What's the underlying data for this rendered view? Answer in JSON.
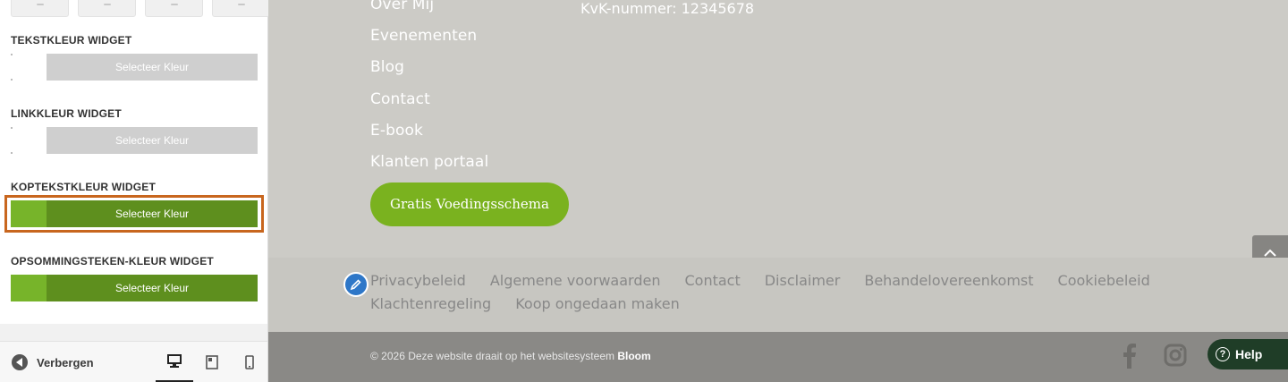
{
  "sidebar": {
    "sections": [
      {
        "title": "TEKSTKLEUR WIDGET",
        "button": "Selecteer Kleur"
      },
      {
        "title": "LINKKLEUR WIDGET",
        "button": "Selecteer Kleur"
      },
      {
        "title": "KOPTEKSTKLEUR WIDGET",
        "button": "Selecteer Kleur",
        "swatch": "#77b42a"
      },
      {
        "title": "OPSOMMINGSTEKEN-KLEUR WIDGET",
        "button": "Selecteer Kleur",
        "swatch": "#77b42a"
      }
    ],
    "footer": {
      "hide_label": "Verbergen",
      "active_device": "desktop"
    }
  },
  "preview": {
    "nav_links": [
      "Over Mij",
      "Evenementen",
      "Blog",
      "Contact",
      "E-book",
      "Klanten portaal"
    ],
    "kvk": "KvK-nummer: 12345678",
    "cta": "Gratis Voedingsschema",
    "footer_links": [
      "Privacybeleid",
      "Algemene voorwaarden",
      "Contact",
      "Disclaimer",
      "Behandelovereenkomst",
      "Cookiebeleid",
      "Klachtenregeling",
      "Koop ongedaan maken"
    ],
    "copyright_prefix": "© 2026 Deze website draait op het websitesysteem",
    "copyright_brand": "Bloom",
    "help_label": "Help"
  },
  "colors": {
    "accent_green": "#77b42a",
    "highlight": "#c8661e",
    "help_bg": "#1f3d27"
  }
}
